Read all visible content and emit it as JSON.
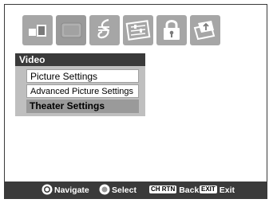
{
  "icon_tabs": [
    {
      "name": "picture-icon",
      "active": false
    },
    {
      "name": "video-icon",
      "active": true
    },
    {
      "name": "audio-icon",
      "active": false
    },
    {
      "name": "setup-icon",
      "active": false
    },
    {
      "name": "lock-icon",
      "active": false
    },
    {
      "name": "applications-icon",
      "active": false
    }
  ],
  "menu": {
    "title": "Video",
    "items": [
      {
        "label": "Picture Settings",
        "selected": false
      },
      {
        "label": "Advanced Picture Settings",
        "selected": false
      },
      {
        "label": "Theater Settings",
        "selected": true
      }
    ]
  },
  "footer": {
    "navigate_label": "Navigate",
    "select_label": "Select",
    "back_key": "CH RTN",
    "back_label": "Back",
    "exit_key": "EXIT",
    "exit_label": "Exit"
  },
  "colors": {
    "header_bg": "#3a3a3a",
    "selected_bg": "#9a9a9a",
    "tab_bg": "#a6a6a6"
  }
}
